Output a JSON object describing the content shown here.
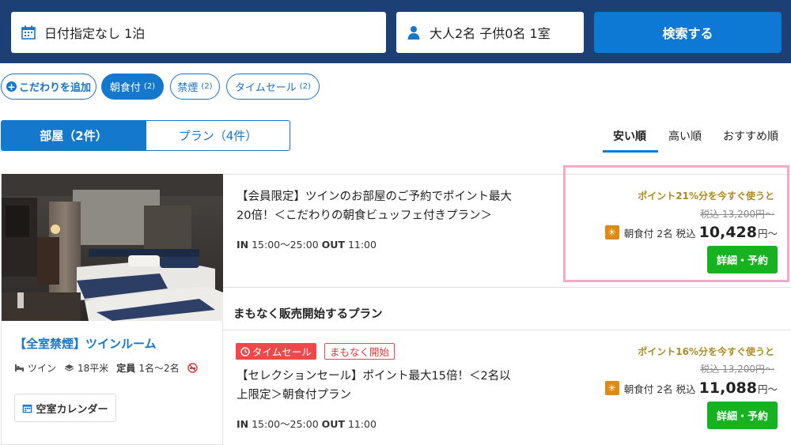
{
  "search": {
    "date_label": "日付指定なし 1泊",
    "guests_label": "大人2名 子供0名 1室",
    "search_button": "検索する"
  },
  "filters": {
    "add_label": "こだわりを追加",
    "chips": [
      {
        "label": "朝食付",
        "count": "(2)",
        "active": true
      },
      {
        "label": "禁煙",
        "count": "(2)",
        "active": false
      },
      {
        "label": "タイムセール",
        "count": "(2)",
        "active": false
      }
    ]
  },
  "tabs": {
    "rooms": "部屋（2件）",
    "plans": "プラン（4件）"
  },
  "sort": {
    "options": [
      "安い順",
      "高い順",
      "おすすめ順"
    ],
    "selected": "安い順"
  },
  "room": {
    "name": "【全室禁煙】ツインルーム",
    "bed_type": "ツイン",
    "size": "18平米",
    "capacity_label": "定員",
    "capacity": "1名～2名",
    "calendar_button": "空室カレンダー"
  },
  "plans": [
    {
      "title": "【会員限定】ツインのお部屋のご予約でポイント最大20倍！＜こだわりの朝食ビュッフェ付きプラン＞",
      "in_label": "IN",
      "in_time": "15:00～25:00",
      "out_label": "OUT",
      "out_time": "11:00",
      "point_msg": "ポイント21%分を今すぐ使うと",
      "original_price": "税込 13,200円～",
      "meal": "朝食付",
      "guests": "2名",
      "tax_label": "税込",
      "price": "10,428",
      "price_suffix": "円～",
      "book_button": "詳細・予約"
    },
    {
      "title": "【セレクションセール】ポイント最大15倍！＜2名以上限定＞朝食付プラン",
      "tags": [
        "タイムセール",
        "まもなく開始"
      ],
      "in_label": "IN",
      "in_time": "15:00～25:00",
      "out_label": "OUT",
      "out_time": "11:00",
      "point_msg": "ポイント16%分を今すぐ使うと",
      "original_price": "税込 13,200円～",
      "meal": "朝食付",
      "guests": "2名",
      "tax_label": "税込",
      "price": "11,088",
      "price_suffix": "円～",
      "book_button": "詳細・予約"
    }
  ],
  "coming_soon_heading": "まもなく販売開始するプラン",
  "colors": {
    "header_bg": "#1c3f75",
    "accent": "#1478cc",
    "book_green": "#17b21f",
    "sale_red": "#f04848",
    "point_gold": "#b08a1e",
    "highlight_pink": "#f5a9c9"
  }
}
